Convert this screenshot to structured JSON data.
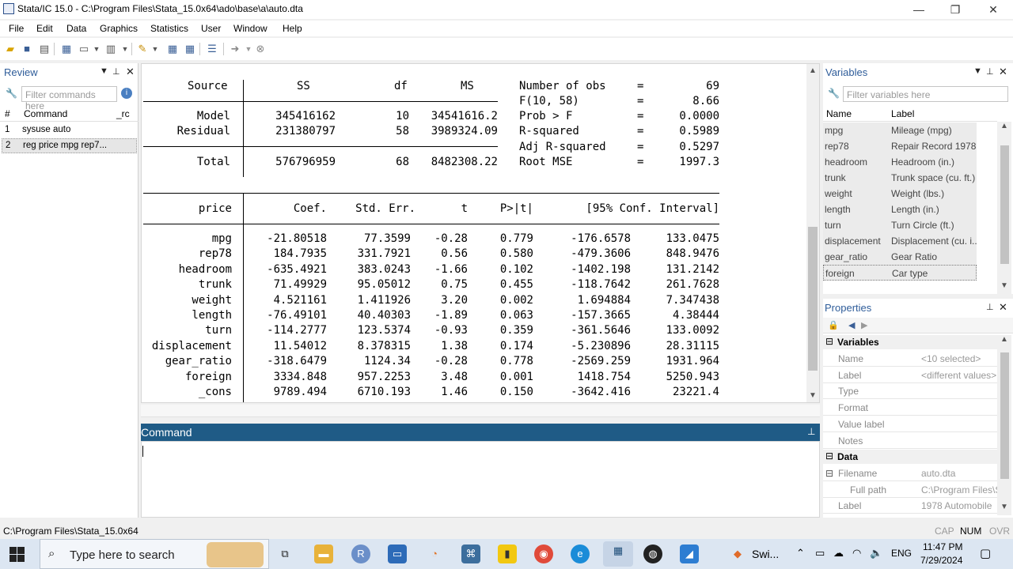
{
  "window": {
    "title": "Stata/IC 15.0 - C:\\Program Files\\Stata_15.0x64\\ado\\base\\a\\auto.dta",
    "minimize": "—",
    "maximize": "❐",
    "close": "✕"
  },
  "menu": [
    "File",
    "Edit",
    "Data",
    "Graphics",
    "Statistics",
    "User",
    "Window",
    "Help"
  ],
  "review": {
    "title": "Review",
    "filter_placeholder": "Filter commands here",
    "columns": {
      "num": "#",
      "command": "Command",
      "rc": "_rc"
    },
    "rows": [
      {
        "num": "1",
        "command": "sysuse auto"
      },
      {
        "num": "2",
        "command": "reg price mpg rep7..."
      }
    ]
  },
  "results": {
    "anova_header": {
      "source": "Source",
      "ss": "SS",
      "df": "df",
      "ms": "MS"
    },
    "anova_rows": [
      {
        "source": "Model",
        "ss": "345416162",
        "df": "10",
        "ms": "34541616.2"
      },
      {
        "source": "Residual",
        "ss": "231380797",
        "df": "58",
        "ms": "3989324.09"
      }
    ],
    "anova_total": {
      "source": "Total",
      "ss": "576796959",
      "df": "68",
      "ms": "8482308.22"
    },
    "stats": [
      {
        "label": "Number of obs",
        "eq": "=",
        "value": "69"
      },
      {
        "label": "F(10, 58)",
        "eq": "=",
        "value": "8.66"
      },
      {
        "label": "Prob > F",
        "eq": "=",
        "value": "0.0000"
      },
      {
        "label": "R-squared",
        "eq": "=",
        "value": "0.5989"
      },
      {
        "label": "Adj R-squared",
        "eq": "=",
        "value": "0.5297"
      },
      {
        "label": "Root MSE",
        "eq": "=",
        "value": "1997.3"
      }
    ],
    "coef_header": {
      "var": "price",
      "coef": "Coef.",
      "se": "Std. Err.",
      "t": "t",
      "p": "P>|t|",
      "ci": "[95% Conf. Interval]"
    },
    "coef_rows": [
      {
        "var": "mpg",
        "coef": "-21.80518",
        "se": "77.3599",
        "t": "-0.28",
        "p": "0.779",
        "lo": "-176.6578",
        "hi": "133.0475"
      },
      {
        "var": "rep78",
        "coef": "184.7935",
        "se": "331.7921",
        "t": "0.56",
        "p": "0.580",
        "lo": "-479.3606",
        "hi": "848.9476"
      },
      {
        "var": "headroom",
        "coef": "-635.4921",
        "se": "383.0243",
        "t": "-1.66",
        "p": "0.102",
        "lo": "-1402.198",
        "hi": "131.2142"
      },
      {
        "var": "trunk",
        "coef": "71.49929",
        "se": "95.05012",
        "t": "0.75",
        "p": "0.455",
        "lo": "-118.7642",
        "hi": "261.7628"
      },
      {
        "var": "weight",
        "coef": "4.521161",
        "se": "1.411926",
        "t": "3.20",
        "p": "0.002",
        "lo": "1.694884",
        "hi": "7.347438"
      },
      {
        "var": "length",
        "coef": "-76.49101",
        "se": "40.40303",
        "t": "-1.89",
        "p": "0.063",
        "lo": "-157.3665",
        "hi": "4.38444"
      },
      {
        "var": "turn",
        "coef": "-114.2777",
        "se": "123.5374",
        "t": "-0.93",
        "p": "0.359",
        "lo": "-361.5646",
        "hi": "133.0092"
      },
      {
        "var": "displacement",
        "coef": "11.54012",
        "se": "8.378315",
        "t": "1.38",
        "p": "0.174",
        "lo": "-5.230896",
        "hi": "28.31115"
      },
      {
        "var": "gear_ratio",
        "coef": "-318.6479",
        "se": "1124.34",
        "t": "-0.28",
        "p": "0.778",
        "lo": "-2569.259",
        "hi": "1931.964"
      },
      {
        "var": "foreign",
        "coef": "3334.848",
        "se": "957.2253",
        "t": "3.48",
        "p": "0.001",
        "lo": "1418.754",
        "hi": "5250.943"
      },
      {
        "var": "_cons",
        "coef": "9789.494",
        "se": "6710.193",
        "t": "1.46",
        "p": "0.150",
        "lo": "-3642.416",
        "hi": "23221.4"
      }
    ]
  },
  "command": {
    "title": "Command"
  },
  "variables": {
    "title": "Variables",
    "filter_placeholder": "Filter variables here",
    "columns": {
      "name": "Name",
      "label": "Label"
    },
    "rows": [
      {
        "name": "mpg",
        "label": "Mileage (mpg)"
      },
      {
        "name": "rep78",
        "label": "Repair Record 1978"
      },
      {
        "name": "headroom",
        "label": "Headroom (in.)"
      },
      {
        "name": "trunk",
        "label": "Trunk space (cu. ft.)"
      },
      {
        "name": "weight",
        "label": "Weight (lbs.)"
      },
      {
        "name": "length",
        "label": "Length (in.)"
      },
      {
        "name": "turn",
        "label": "Turn Circle (ft.)"
      },
      {
        "name": "displacement",
        "label": "Displacement (cu. i..."
      },
      {
        "name": "gear_ratio",
        "label": "Gear Ratio"
      },
      {
        "name": "foreign",
        "label": "Car type"
      }
    ]
  },
  "properties": {
    "title": "Properties",
    "variables_section": "Variables",
    "var_props": [
      {
        "label": "Name",
        "value": "<10 selected>"
      },
      {
        "label": "Label",
        "value": "<different values>"
      },
      {
        "label": "Type",
        "value": ""
      },
      {
        "label": "Format",
        "value": ""
      },
      {
        "label": "Value label",
        "value": ""
      },
      {
        "label": "Notes",
        "value": ""
      }
    ],
    "data_section": "Data",
    "data_props": [
      {
        "label": "Filename",
        "value": "auto.dta"
      },
      {
        "label": "Full path",
        "value": "C:\\Program Files\\S"
      },
      {
        "label": "Label",
        "value": "1978 Automobile"
      }
    ]
  },
  "status": {
    "path": "C:\\Program Files\\Stata_15.0x64",
    "caps": "CAP",
    "num": "NUM",
    "ovr": "OVR"
  },
  "taskbar": {
    "search_placeholder": "Type here to search",
    "running_app": "Swi...",
    "lang": "ENG",
    "time": "11:47 PM",
    "date": "7/29/2024"
  }
}
